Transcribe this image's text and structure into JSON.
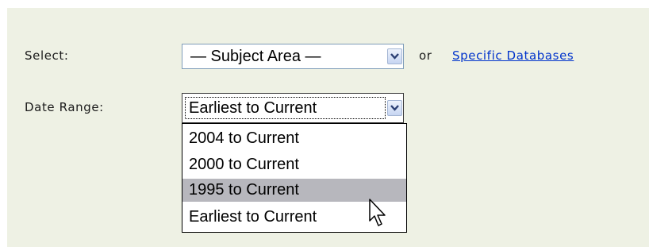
{
  "form": {
    "select_label": "Select:",
    "subject_select_value": "— Subject Area —",
    "or_text": "or",
    "specific_databases_link": "Specific Databases",
    "date_range_label": "Date Range:",
    "date_range_value": "Earliest to Current",
    "date_range_options": [
      "2004 to Current",
      "2000 to Current",
      "1995 to Current",
      "Earliest to Current"
    ],
    "highlighted_option": "1995 to Current"
  },
  "colors": {
    "panel_background": "#eef1e4",
    "link": "#0033cc",
    "highlight": "#b7b7bd"
  },
  "icons": [
    "chevron-down-icon",
    "mouse-pointer-icon"
  ]
}
